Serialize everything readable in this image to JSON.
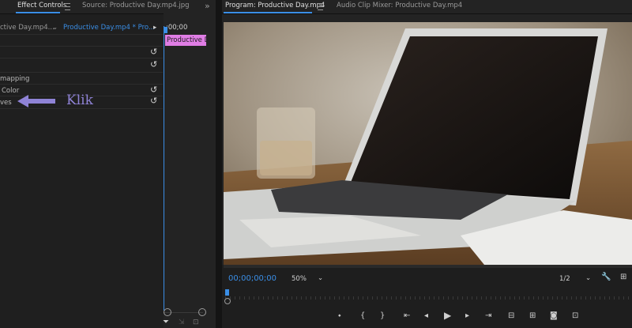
{
  "left_panel": {
    "tabs": [
      {
        "label": "Effect Controls"
      },
      {
        "label": "Source: Productive Day.mp4.jpg"
      }
    ],
    "collapse_glyph": "»",
    "clip_master": "ctive Day.mp4...",
    "clip_sequence": "Productive Day.mp4 * Pro...",
    "timecode": ";00;00",
    "clip_block_label": "Productive D",
    "rows": [
      "mapping",
      "Color",
      "ves"
    ],
    "annotation": "Klik"
  },
  "program": {
    "tabs": [
      {
        "label": "Program: Productive Day.mp4"
      },
      {
        "label": "Audio Clip Mixer: Productive Day.mp4"
      }
    ],
    "timecode": "00;00;00;00",
    "zoom": "50%",
    "resolution": "1/2"
  },
  "colors": {
    "accent_blue": "#3a8ee6",
    "clip_pink": "#e07de5",
    "annotation_purple": "#8f83d6"
  }
}
